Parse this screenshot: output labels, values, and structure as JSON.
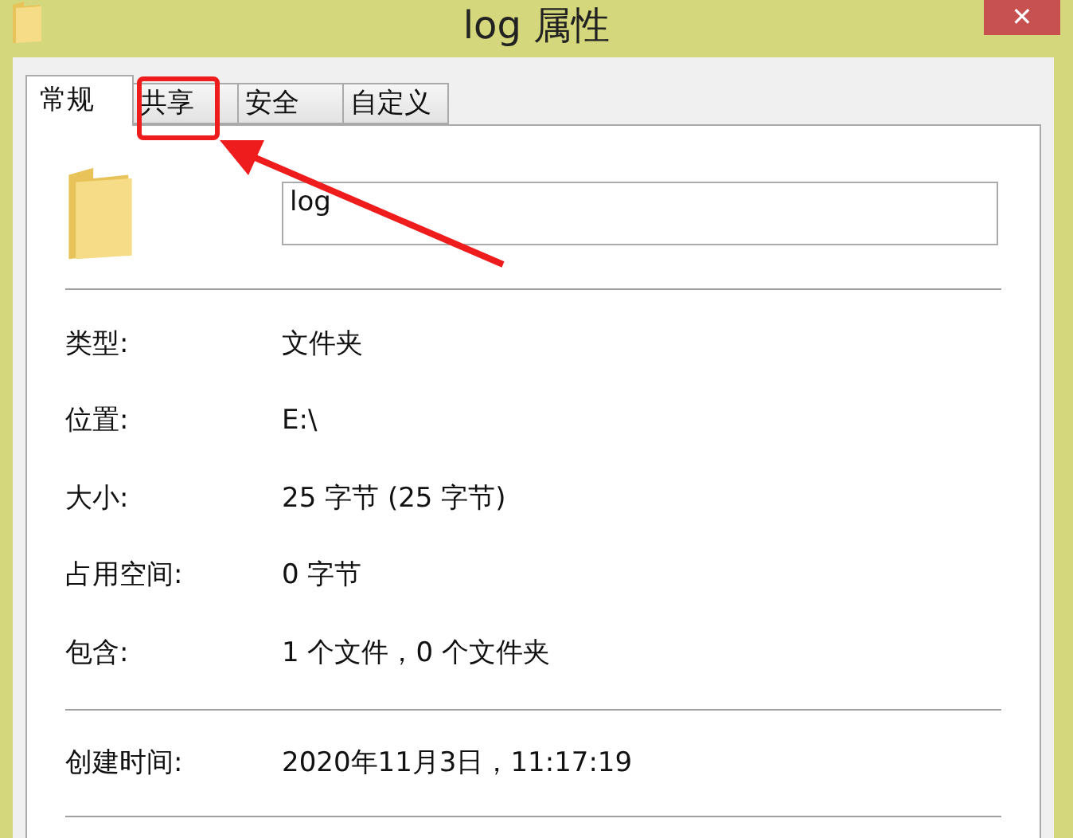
{
  "window": {
    "title": "log 属性",
    "close": "✕"
  },
  "tabs": [
    {
      "label": "常规",
      "selected": true
    },
    {
      "label": "共享",
      "selected": false
    },
    {
      "label": "安全",
      "selected": false
    },
    {
      "label": "自定义",
      "selected": false
    }
  ],
  "name_field": {
    "value": "log"
  },
  "properties": [
    {
      "label": "类型:",
      "value": "文件夹"
    },
    {
      "label": "位置:",
      "value": "E:\\"
    },
    {
      "label": "大小:",
      "value": "25 字节 (25 字节)"
    },
    {
      "label": "占用空间:",
      "value": "0 字节"
    },
    {
      "label": "包含:",
      "value": "1 个文件，0 个文件夹"
    }
  ],
  "dates": [
    {
      "label": "创建时间:",
      "value": "2020年11月3日，11:17:19"
    }
  ]
}
